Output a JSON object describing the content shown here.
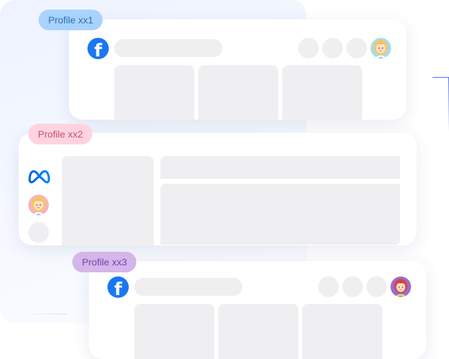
{
  "profiles": [
    {
      "label": "Profile xx1",
      "platform_icon": "facebook-icon",
      "avatar": "blonde-woman-avatar"
    },
    {
      "label": "Profile xx2",
      "platform_icon": "meta-icon",
      "avatar": "blonde-woman-avatar"
    },
    {
      "label": "Profile xx3",
      "platform_icon": "facebook-icon",
      "avatar": "red-haired-woman-avatar"
    }
  ],
  "icons": {
    "facebook_glyph": "f"
  },
  "colors": {
    "facebook_blue": "#1877f2",
    "tag_blue_bg": "#a9d2ff",
    "tag_blue_text": "#2f6fb2",
    "tag_pink_bg": "#ffd3df",
    "tag_pink_text": "#c4506f",
    "tag_purple_bg": "#d4b6ea",
    "tag_purple_text": "#7a3fa7",
    "placeholder_gray": "#efeff2"
  }
}
